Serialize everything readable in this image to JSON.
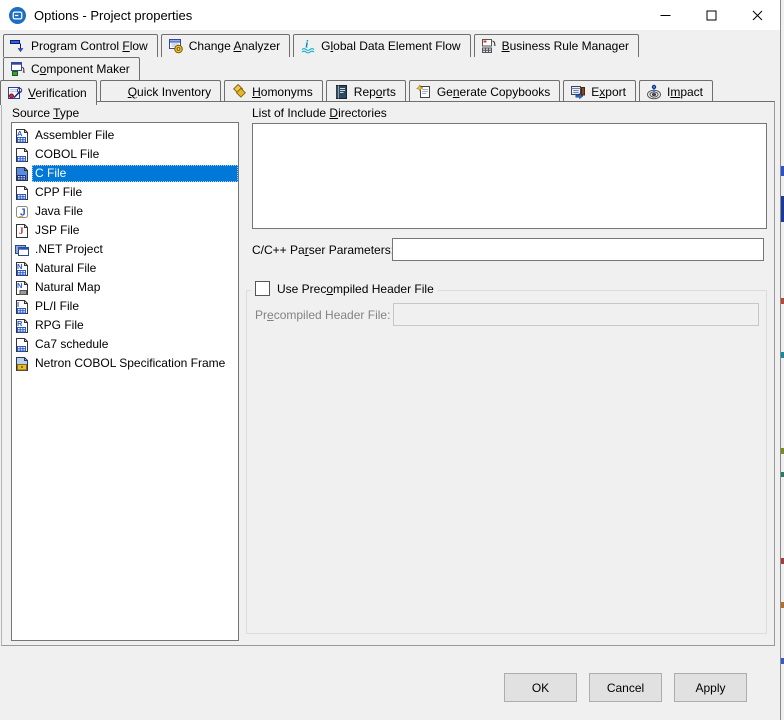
{
  "window": {
    "title": "Options - Project properties"
  },
  "tab_rows": [
    [
      {
        "label": "Program Control Flow",
        "mnemonic": 16,
        "icon": "program-control-flow"
      },
      {
        "label": "Change Analyzer",
        "mnemonic": 7,
        "icon": "change-analyzer"
      },
      {
        "label": "Global Data Element Flow",
        "mnemonic": 1,
        "icon": "global-data-element-flow"
      },
      {
        "label": "Business Rule Manager",
        "mnemonic": 0,
        "icon": "business-rule-manager"
      }
    ],
    [
      {
        "label": "Component Maker",
        "mnemonic": 1,
        "icon": "component-maker"
      }
    ],
    [
      {
        "label": "Verification",
        "mnemonic": 0,
        "icon": "verification",
        "active": true
      },
      {
        "label": "Quick Inventory",
        "mnemonic": 0,
        "icon": "quick-inventory"
      },
      {
        "label": "Homonyms",
        "mnemonic": 0,
        "icon": "homonyms"
      },
      {
        "label": "Reports",
        "mnemonic": 3,
        "icon": "reports"
      },
      {
        "label": "Generate Copybooks",
        "mnemonic": 2,
        "icon": "generate-copybooks"
      },
      {
        "label": "Export",
        "mnemonic": 1,
        "icon": "export"
      },
      {
        "label": "Impact",
        "mnemonic": 1,
        "icon": "impact"
      }
    ]
  ],
  "verification_page": {
    "source_type_label": {
      "label": "Source Type",
      "mnemonic": 7
    },
    "source_types": [
      {
        "label": "Assembler File",
        "icon": "assembler-file"
      },
      {
        "label": "COBOL File",
        "icon": "cobol-file"
      },
      {
        "label": "C File",
        "icon": "c-file",
        "selected": true
      },
      {
        "label": "CPP File",
        "icon": "cpp-file"
      },
      {
        "label": "Java File",
        "icon": "java-file"
      },
      {
        "label": "JSP File",
        "icon": "jsp-file"
      },
      {
        "label": ".NET Project",
        "icon": "dotnet-project"
      },
      {
        "label": "Natural File",
        "icon": "natural-file"
      },
      {
        "label": "Natural Map",
        "icon": "natural-map"
      },
      {
        "label": "PL/I File",
        "icon": "pli-file"
      },
      {
        "label": "RPG File",
        "icon": "rpg-file"
      },
      {
        "label": "Ca7 schedule",
        "icon": "ca7-schedule"
      },
      {
        "label": "Netron COBOL Specification Frame",
        "icon": "netron-cobol-specification-frame"
      }
    ],
    "include_directories": {
      "label": "List of Include Directories",
      "mnemonic": 16,
      "items": []
    },
    "parser_parameters": {
      "label": "C/C++ Parser Parameters:",
      "mnemonic": 8,
      "value": ""
    },
    "precompiled": {
      "checkbox_label": {
        "label": "Use Precompiled Header File",
        "mnemonic": 8
      },
      "checked": false,
      "field_label": {
        "label": "Precompiled Header File:",
        "mnemonic": 2
      },
      "value": "",
      "disabled": true
    }
  },
  "buttons": {
    "ok": "OK",
    "cancel": "Cancel",
    "apply": "Apply"
  },
  "colors": {
    "selection": "#0078d7",
    "titlebar_bg": "#ffffff",
    "dialog_bg": "#f0f0f0"
  }
}
